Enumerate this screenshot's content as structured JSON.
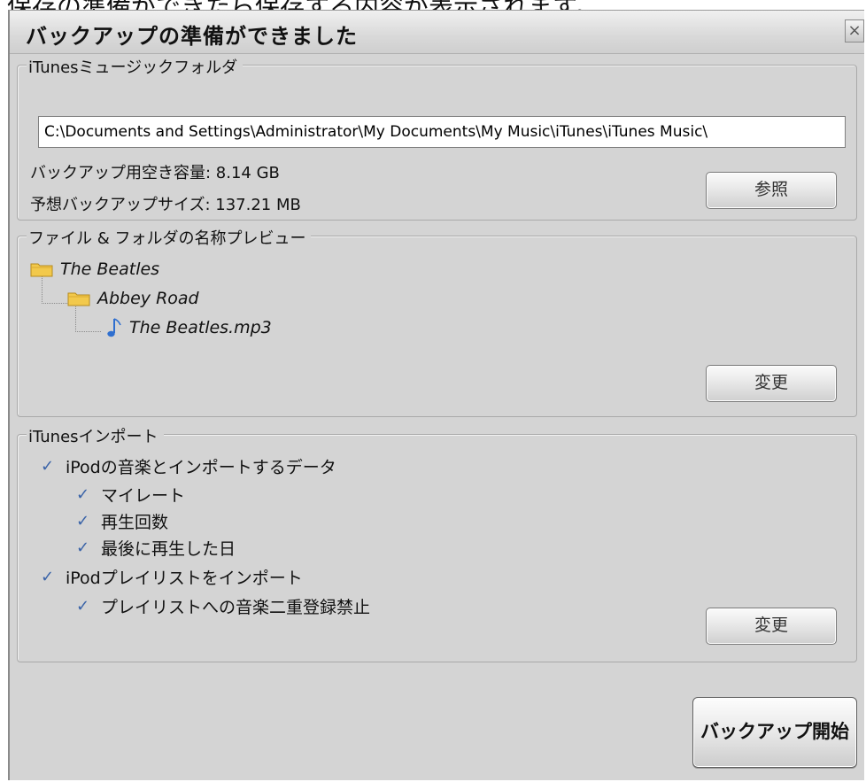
{
  "page_caption": "保存の準備ができたら保存する内容が表示されます。",
  "window": {
    "title": "バックアップの準備ができました",
    "close_glyph": "×"
  },
  "folder_group": {
    "legend": "iTunesミュージックフォルダ",
    "path_value": "C:\\Documents and Settings\\Administrator\\My Documents\\My Music\\iTunes\\iTunes Music\\",
    "free_space_label": "バックアップ用空き容量: 8.14 GB",
    "estimated_size_label": "予想バックアップサイズ: 137.21 MB",
    "browse_button": "参照"
  },
  "preview_group": {
    "legend": "ファイル & フォルダの名称プレビュー",
    "tree": [
      {
        "label": "The Beatles",
        "icon": "folder-icon",
        "level": 0
      },
      {
        "label": "Abbey Road",
        "icon": "folder-icon",
        "level": 1
      },
      {
        "label": "The Beatles.mp3",
        "icon": "music-note-icon",
        "level": 2
      }
    ],
    "change_button": "変更"
  },
  "import_group": {
    "legend": "iTunesインポート",
    "check_glyph": "✓",
    "options": [
      {
        "label": "iPodの音楽とインポートするデータ",
        "level": 0,
        "checked": true
      },
      {
        "label": "マイレート",
        "level": 1,
        "checked": true
      },
      {
        "label": "再生回数",
        "level": 1,
        "checked": true
      },
      {
        "label": "最後に再生した日",
        "level": 1,
        "checked": true
      },
      {
        "label": "iPodプレイリストをインポート",
        "level": 0,
        "checked": true
      },
      {
        "label": "プレイリストへの音楽二重登録禁止",
        "level": 1,
        "checked": true
      }
    ],
    "change_button": "変更"
  },
  "footer": {
    "start_backup_button": "バックアップ開始"
  },
  "colors": {
    "dialog_bg": "#d4d4d4",
    "check_color": "#3a63a8",
    "folder_fill": "#f2c94c",
    "note_color": "#2f6fcf"
  }
}
